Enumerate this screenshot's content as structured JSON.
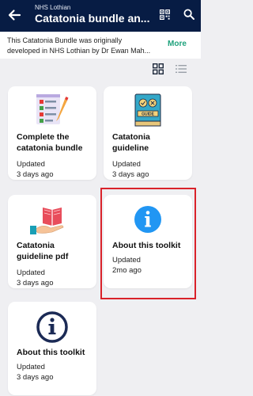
{
  "header": {
    "org": "NHS Lothian",
    "title": "Catatonia bundle an...",
    "back_icon": "back-arrow-icon",
    "qr_icon": "qr-code-icon",
    "search_icon": "search-icon"
  },
  "description": {
    "line1": "This Catatonia Bundle was originally",
    "line2": "developed in NHS Lothian by Dr Ewan Mah...",
    "more_label": "More"
  },
  "view_toggle": {
    "grid_icon": "grid-view-icon",
    "list_icon": "list-view-icon"
  },
  "cards": [
    {
      "title_line1": "Complete the",
      "title_line2": "catatonia bundle",
      "updated_label": "Updated",
      "updated_time": "3 days ago",
      "icon": "checklist-icon"
    },
    {
      "title_line1": "Catatonia",
      "title_line2": "guideline",
      "updated_label": "Updated",
      "updated_time": "3 days ago",
      "icon": "guide-book-icon"
    },
    {
      "title_line1": "Catatonia",
      "title_line2": "guideline pdf",
      "updated_label": "Updated",
      "updated_time": "3 days ago",
      "icon": "book-in-hand-icon"
    },
    {
      "title_line1": "About this toolkit",
      "title_line2": "",
      "updated_label": "Updated",
      "updated_time": "2mo ago",
      "icon": "info-circle-icon"
    },
    {
      "title_line1": "About this toolkit",
      "title_line2": "",
      "updated_label": "Updated",
      "updated_time": "3 days ago",
      "icon": "info-outline-icon"
    }
  ],
  "colors": {
    "header_bg": "#071c44",
    "accent": "#1fa27c",
    "info_blue": "#2196f3",
    "highlight": "#d9222a"
  }
}
